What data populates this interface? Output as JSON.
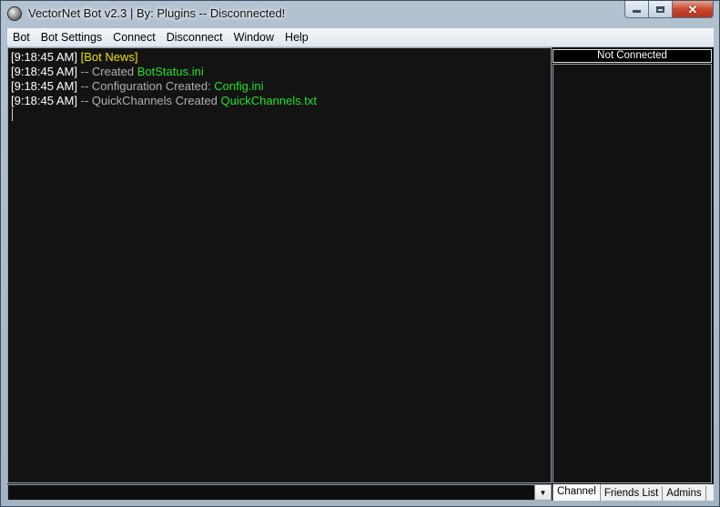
{
  "window": {
    "title": "VectorNet Bot v2.3 | By: Plugins -- Disconnected!"
  },
  "menu": {
    "items": [
      "Bot",
      "Bot Settings",
      "Connect",
      "Disconnect",
      "Window",
      "Help"
    ]
  },
  "console": {
    "lines": [
      {
        "time": "[9:18:45 AM]",
        "text": "",
        "highlight": "[Bot News]",
        "highlight_color": "yellow"
      },
      {
        "time": "[9:18:45 AM]",
        "text": " -- Created ",
        "highlight": "BotStatus.ini",
        "highlight_color": "green"
      },
      {
        "time": "[9:18:45 AM]",
        "text": " -- Configuration Created: ",
        "highlight": "Config.ini",
        "highlight_color": "green"
      },
      {
        "time": "[9:18:45 AM]",
        "text": " -- QuickChannels Created ",
        "highlight": "QuickChannels.txt",
        "highlight_color": "green"
      }
    ]
  },
  "side": {
    "status": "Not Connected",
    "tabs": [
      "Channel",
      "Friends List",
      "Admins"
    ],
    "active_tab": 0
  },
  "colors": {
    "console_bg": "#131313",
    "timestamp": "#ffffff",
    "message": "#b0b0b0",
    "yellow": "#f0e000",
    "green": "#22e22a"
  },
  "icons": {
    "app": "globe-icon",
    "minimize": "minimize-icon",
    "maximize": "maximize-icon",
    "close": "close-icon",
    "dropdown": "chevron-down-icon"
  }
}
